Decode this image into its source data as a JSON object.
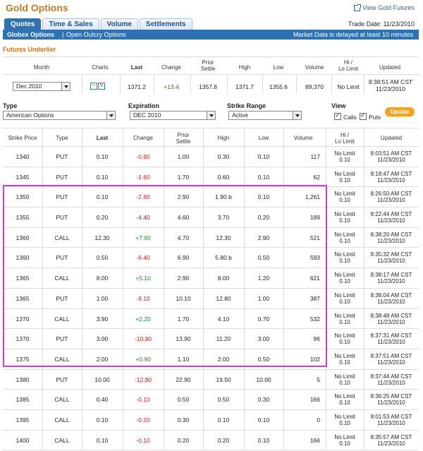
{
  "app": {
    "title": "Gold Options",
    "view_link": "View Gold Futures",
    "trade_date": "Trade Date: 11/23/2010"
  },
  "tabs": [
    {
      "label": "Quotes"
    },
    {
      "label": "Time & Sales"
    },
    {
      "label": "Volume"
    },
    {
      "label": "Settlements"
    }
  ],
  "subnav": {
    "globex": "Globex Options",
    "separator": "|",
    "open_outcry": "Open Outcry Options",
    "delay": "Market Data is delayed at least 10 minutes"
  },
  "futures": {
    "section_title": "Futures Underlier",
    "headers": {
      "month": "Month",
      "charts": "Charts",
      "last": "Last",
      "change": "Change",
      "prior": "Prior\nSettle",
      "high": "High",
      "low": "Low",
      "volume": "Volume",
      "hilo": "Hi /\nLo Limit",
      "updated": "Updated"
    },
    "row": {
      "month": "Dec 2010",
      "last": "1371.2",
      "change": "+13.4",
      "prior": "1357.8",
      "high": "1371.7",
      "low": "1355.6",
      "volume": "89,370",
      "hilo": "No Limit",
      "updated": "8:38:51 AM CST\n11/23/2010"
    }
  },
  "filters": {
    "type_label": "Type",
    "type_value": "American Options",
    "expiration_label": "Expiration",
    "expiration_value": "DEC 2010",
    "strike_label": "Strike Range",
    "strike_value": "Active",
    "view_label": "View",
    "calls_label": "Calls",
    "puts_label": "Puts",
    "calls_checked": true,
    "puts_checked": true,
    "update_label": "Update"
  },
  "options_table": {
    "headers": [
      "Strike Price",
      "Type",
      "Last",
      "Change",
      "Prior\nSettle",
      "High",
      "Low",
      "Volume",
      "Hi /\nLo Limit",
      "Updated"
    ],
    "rows": [
      {
        "strike": "1340",
        "type": "PUT",
        "last": "0.10",
        "change": "-0.90",
        "prior": "1.00",
        "high": "0.30",
        "low": "0.10",
        "volume": "117",
        "hilo": "No Limit\n0.10",
        "updated": "8:03:51 AM CST\n11/23/2010"
      },
      {
        "strike": "1345",
        "type": "PUT",
        "last": "0.10",
        "change": "-1.60",
        "prior": "1.70",
        "high": "0.60",
        "low": "0.10",
        "volume": "62",
        "hilo": "No Limit\n0.10",
        "updated": "8:18:47 AM CST\n11/23/2010"
      },
      {
        "strike": "1350",
        "type": "PUT",
        "last": "0.10",
        "change": "-2.80",
        "prior": "2.90",
        "high": "1.90 b",
        "low": "0.10",
        "volume": "1,261",
        "hilo": "No Limit\n0.10",
        "updated": "8:26:50 AM CST\n11/23/2010"
      },
      {
        "strike": "1355",
        "type": "PUT",
        "last": "0.20",
        "change": "-4.40",
        "prior": "4.60",
        "high": "3.70",
        "low": "0.20",
        "volume": "189",
        "hilo": "No Limit\n0.10",
        "updated": "8:22:44 AM CST\n11/23/2010"
      },
      {
        "strike": "1360",
        "type": "CALL",
        "last": "12.30",
        "change": "+7.60",
        "prior": "4.70",
        "high": "12.30",
        "low": "2.90",
        "volume": "521",
        "hilo": "No Limit\n0.10",
        "updated": "8:38:20 AM CST\n11/23/2010"
      },
      {
        "strike": "1360",
        "type": "PUT",
        "last": "0.50",
        "change": "-6.40",
        "prior": "6.90",
        "high": "5.80 b",
        "low": "0.50",
        "volume": "593",
        "hilo": "No Limit\n0.10",
        "updated": "8:35:32 AM CST\n11/23/2010"
      },
      {
        "strike": "1365",
        "type": "CALL",
        "last": "8.00",
        "change": "+5.10",
        "prior": "2.90",
        "high": "8.00",
        "low": "1.20",
        "volume": "621",
        "hilo": "No Limit\n0.10",
        "updated": "8:38:17 AM CST\n11/23/2010"
      },
      {
        "strike": "1365",
        "type": "PUT",
        "last": "1.00",
        "change": "-9.10",
        "prior": "10.10",
        "high": "12.80",
        "low": "1.00",
        "volume": "387",
        "hilo": "No Limit\n0.10",
        "updated": "8:38:04 AM CST\n11/23/2010"
      },
      {
        "strike": "1370",
        "type": "CALL",
        "last": "3.90",
        "change": "+2.20",
        "prior": "1.70",
        "high": "4.10",
        "low": "0.70",
        "volume": "532",
        "hilo": "No Limit\n0.10",
        "updated": "8:38:48 AM CST\n11/23/2010"
      },
      {
        "strike": "1370",
        "type": "PUT",
        "last": "3.00",
        "change": "-10.90",
        "prior": "13.90",
        "high": "11.20",
        "low": "3.00",
        "volume": "96",
        "hilo": "No Limit\n0.10",
        "updated": "8:37:31 AM CST\n11/23/2010"
      },
      {
        "strike": "1375",
        "type": "CALL",
        "last": "2.00",
        "change": "+0.90",
        "prior": "1.10",
        "high": "2.00",
        "low": "0.50",
        "volume": "102",
        "hilo": "No Limit\n0.10",
        "updated": "8:37:51 AM CST\n11/23/2010"
      },
      {
        "strike": "1380",
        "type": "PUT",
        "last": "10.00",
        "change": "-12.90",
        "prior": "22.90",
        "high": "19.50",
        "low": "10.00",
        "volume": "5",
        "hilo": "No Limit\n0.10",
        "updated": "8:37:44 AM CST\n11/23/2010"
      },
      {
        "strike": "1385",
        "type": "CALL",
        "last": "0.40",
        "change": "-0.10",
        "prior": "0.50",
        "high": "0.50",
        "low": "0.30",
        "volume": "166",
        "hilo": "No Limit\n0.10",
        "updated": "8:36:25 AM CST\n11/23/2010"
      },
      {
        "strike": "1395",
        "type": "CALL",
        "last": "0.10",
        "change": "-0.20",
        "prior": "0.30",
        "high": "0.10",
        "low": "0.10",
        "volume": "0",
        "hilo": "No Limit\n0.10",
        "updated": "8:01:53 AM CST\n11/23/2010"
      },
      {
        "strike": "1400",
        "type": "CALL",
        "last": "0.10",
        "change": "-0.10",
        "prior": "0.20",
        "high": "0.20",
        "low": "0.10",
        "volume": "166",
        "hilo": "No Limit\n0.10",
        "updated": "8:35:57 AM CST\n11/23/2010"
      }
    ]
  },
  "colors": {
    "brand_orange": "#c8781e",
    "nav_blue": "#2e72b3",
    "negative": "#cc1b1b",
    "positive": "#1c8a1c",
    "highlight_box": "#d23bd3",
    "update_button": "#f3a21b"
  }
}
